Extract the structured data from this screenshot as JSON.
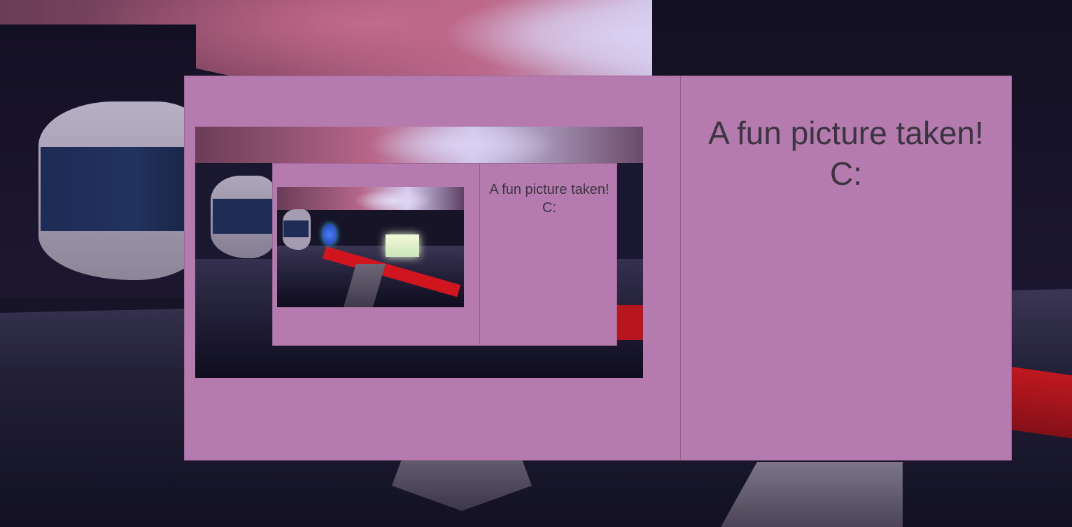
{
  "album": {
    "caption": "A fun picture taken! C:",
    "photo": {
      "nested_album": {
        "caption": "A fun picture taken! C:"
      }
    }
  }
}
